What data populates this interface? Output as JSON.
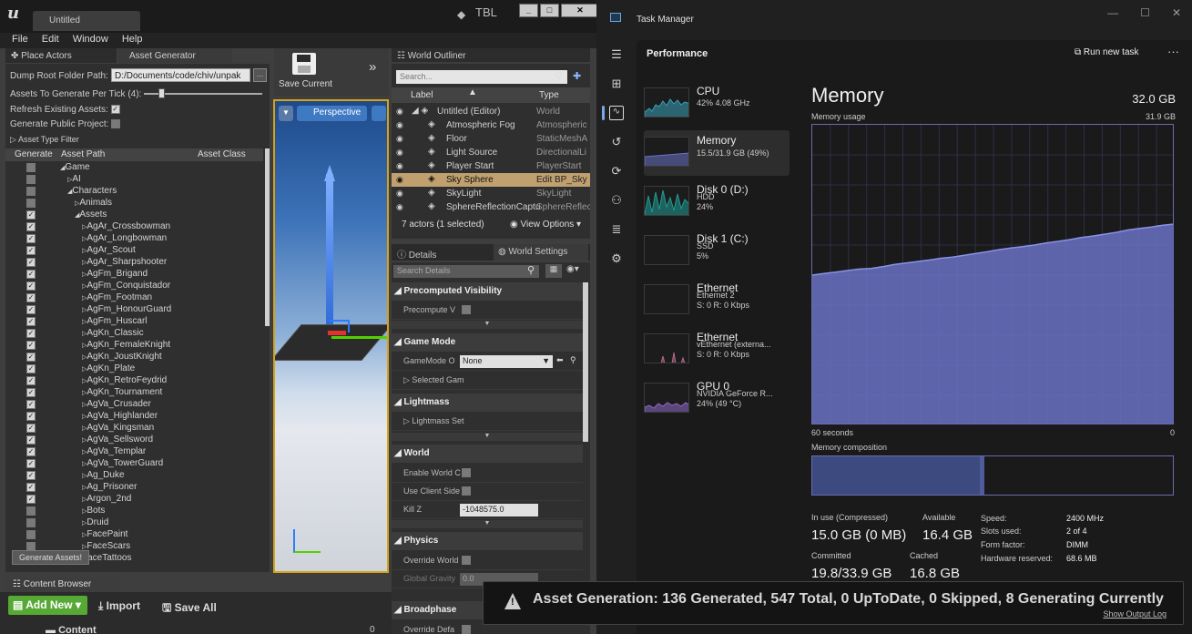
{
  "ue": {
    "tab_title": "Untitled",
    "tbl": "TBL",
    "menu": [
      "File",
      "Edit",
      "Window",
      "Help"
    ],
    "tabs": {
      "place_actors": "Place Actors",
      "asset_generator": "Asset Generator"
    },
    "asset_gen": {
      "dump_label": "Dump Root Folder Path:",
      "dump_value": "D:/Documents/code/chiv/unpak",
      "per_tick_label": "Assets To Generate Per Tick (4):",
      "refresh_label": "Refresh Existing Assets:",
      "public_label": "Generate Public Project:",
      "filter_label": "Asset Type Filter",
      "col_generate": "Generate",
      "col_path": "Asset Path",
      "col_class": "Asset Class",
      "generate_btn": "Generate Assets!",
      "tree": [
        {
          "label": "Game",
          "indent": 0,
          "arrow": "open",
          "checked": false
        },
        {
          "label": "AI",
          "indent": 1,
          "arrow": "closed",
          "checked": false
        },
        {
          "label": "Characters",
          "indent": 1,
          "arrow": "open",
          "checked": false
        },
        {
          "label": "Animals",
          "indent": 2,
          "arrow": "closed",
          "checked": false
        },
        {
          "label": "Assets",
          "indent": 2,
          "arrow": "open",
          "checked": true
        },
        {
          "label": "AgAr_Crossbowman",
          "indent": 3,
          "arrow": "closed",
          "checked": true
        },
        {
          "label": "AgAr_Longbowman",
          "indent": 3,
          "arrow": "closed",
          "checked": true
        },
        {
          "label": "AgAr_Scout",
          "indent": 3,
          "arrow": "closed",
          "checked": true
        },
        {
          "label": "AgAr_Sharpshooter",
          "indent": 3,
          "arrow": "closed",
          "checked": true
        },
        {
          "label": "AgFm_Brigand",
          "indent": 3,
          "arrow": "closed",
          "checked": true
        },
        {
          "label": "AgFm_Conquistador",
          "indent": 3,
          "arrow": "closed",
          "checked": true
        },
        {
          "label": "AgFm_Footman",
          "indent": 3,
          "arrow": "closed",
          "checked": true
        },
        {
          "label": "AgFm_HonourGuard",
          "indent": 3,
          "arrow": "closed",
          "checked": true
        },
        {
          "label": "AgFm_Huscarl",
          "indent": 3,
          "arrow": "closed",
          "checked": true
        },
        {
          "label": "AgKn_Classic",
          "indent": 3,
          "arrow": "closed",
          "checked": true
        },
        {
          "label": "AgKn_FemaleKnight",
          "indent": 3,
          "arrow": "closed",
          "checked": true
        },
        {
          "label": "AgKn_JoustKnight",
          "indent": 3,
          "arrow": "closed",
          "checked": true
        },
        {
          "label": "AgKn_Plate",
          "indent": 3,
          "arrow": "closed",
          "checked": true
        },
        {
          "label": "AgKn_RetroFeydrid",
          "indent": 3,
          "arrow": "closed",
          "checked": true
        },
        {
          "label": "AgKn_Tournament",
          "indent": 3,
          "arrow": "closed",
          "checked": true
        },
        {
          "label": "AgVa_Crusader",
          "indent": 3,
          "arrow": "closed",
          "checked": true
        },
        {
          "label": "AgVa_Highlander",
          "indent": 3,
          "arrow": "closed",
          "checked": true
        },
        {
          "label": "AgVa_Kingsman",
          "indent": 3,
          "arrow": "closed",
          "checked": true
        },
        {
          "label": "AgVa_Sellsword",
          "indent": 3,
          "arrow": "closed",
          "checked": true
        },
        {
          "label": "AgVa_Templar",
          "indent": 3,
          "arrow": "closed",
          "checked": true
        },
        {
          "label": "AgVa_TowerGuard",
          "indent": 3,
          "arrow": "closed",
          "checked": true
        },
        {
          "label": "Ag_Duke",
          "indent": 3,
          "arrow": "closed",
          "checked": true
        },
        {
          "label": "Ag_Prisoner",
          "indent": 3,
          "arrow": "closed",
          "checked": true
        },
        {
          "label": "Argon_2nd",
          "indent": 3,
          "arrow": "closed",
          "checked": true
        },
        {
          "label": "Bots",
          "indent": 3,
          "arrow": "closed",
          "checked": false
        },
        {
          "label": "Druid",
          "indent": 3,
          "arrow": "closed",
          "checked": false
        },
        {
          "label": "FacePaint",
          "indent": 3,
          "arrow": "closed",
          "checked": false
        },
        {
          "label": "FaceScars",
          "indent": 3,
          "arrow": "closed",
          "checked": false
        },
        {
          "label": "FaceTattoos",
          "indent": 3,
          "arrow": "none",
          "checked": false
        }
      ]
    },
    "toolbar": {
      "save_label": "Save Current"
    },
    "viewport": {
      "perspective": "Perspective"
    },
    "outliner": {
      "tab": "World Outliner",
      "search_placeholder": "Search...",
      "col_label": "Label",
      "col_type": "Type",
      "rows": [
        {
          "label": "Untitled (Editor)",
          "type": "World",
          "selected": false
        },
        {
          "label": "Atmospheric Fog",
          "type": "Atmospheric",
          "selected": false
        },
        {
          "label": "Floor",
          "type": "StaticMeshA",
          "selected": false
        },
        {
          "label": "Light Source",
          "type": "DirectionalLi",
          "selected": false
        },
        {
          "label": "Player Start",
          "type": "PlayerStart",
          "selected": false
        },
        {
          "label": "Sky Sphere",
          "type": "Edit BP_Sky",
          "selected": true
        },
        {
          "label": "SkyLight",
          "type": "SkyLight",
          "selected": false
        },
        {
          "label": "SphereReflectionCaptu",
          "type": "SphereReflec",
          "selected": false
        }
      ],
      "actors_count": "7 actors (1 selected)",
      "view_options": "View Options"
    },
    "details": {
      "tab_details": "Details",
      "tab_world": "World Settings",
      "search_placeholder": "Search Details",
      "sections": {
        "precomputed": "Precomputed Visibility",
        "game_mode": "Game Mode",
        "lightmass": "Lightmass",
        "world": "World",
        "physics": "Physics",
        "broadphase": "Broadphase"
      },
      "rows": {
        "precompute": "Precompute V",
        "gamemode": "GameMode O",
        "gamemode_value": "None",
        "selected_game": "Selected Gam",
        "lightmass_set": "Lightmass Set",
        "enable_world": "Enable World C",
        "use_client": "Use Client Side",
        "kill_z": "Kill Z",
        "kill_z_value": "-1048575.0",
        "override_world": "Override World",
        "global_gravity": "Global Gravity",
        "global_gravity_value": "0.0",
        "override_default": "Override Defa"
      }
    },
    "content_browser": {
      "tab": "Content Browser",
      "add_new": "Add New",
      "import": "Import",
      "save_all": "Save All",
      "content": "Content",
      "count": "0"
    },
    "notification": {
      "text": "Asset Generation: 136 Generated, 547 Total, 0 UpToDate, 0 Skipped, 8 Generating Currently",
      "link": "Show Output Log"
    }
  },
  "tm": {
    "title": "Task Manager",
    "section": "Performance",
    "run_new_task": "Run new task",
    "items": [
      {
        "name": "CPU",
        "sub1": "42% 4.08 GHz",
        "sub2": "",
        "sub3": "",
        "color": "#3aa0b8"
      },
      {
        "name": "Memory",
        "sub1": "15.5/31.9 GB (49%)",
        "sub2": "",
        "sub3": "",
        "color": "#6b73c9"
      },
      {
        "name": "Disk 0 (D:)",
        "sub1": "HDD",
        "sub2": "24%",
        "sub3": "",
        "color": "#1f9c93"
      },
      {
        "name": "Disk 1 (C:)",
        "sub1": "SSD",
        "sub2": "5%",
        "sub3": "",
        "color": "#1f9c93"
      },
      {
        "name": "Ethernet",
        "sub1": "Ethernet 2",
        "sub2": "S: 0 R: 0 Kbps",
        "sub3": "",
        "color": "#b06a8a"
      },
      {
        "name": "Ethernet",
        "sub1": "vEthernet (externa...",
        "sub2": "S: 0 R: 0 Kbps",
        "sub3": "",
        "color": "#b06a8a"
      },
      {
        "name": "GPU 0",
        "sub1": "NVIDIA GeForce R...",
        "sub2": "24% (49 °C)",
        "sub3": "",
        "color": "#8f6ac9"
      }
    ],
    "memory": {
      "title": "Memory",
      "total": "32.0 GB",
      "usage_label": "Memory usage",
      "usage_max": "31.9 GB",
      "seconds": "60 seconds",
      "zero": "0",
      "composition_label": "Memory composition",
      "composition_in_use_fraction": 0.47,
      "in_use_label": "In use (Compressed)",
      "in_use_value": "15.0 GB (0 MB)",
      "available_label": "Available",
      "available_value": "16.4 GB",
      "committed_label": "Committed",
      "committed_value": "19.8/33.9 GB",
      "cached_label": "Cached",
      "cached_value": "16.8 GB",
      "kv": [
        {
          "k": "Speed:",
          "v": "2400 MHz"
        },
        {
          "k": "Slots used:",
          "v": "2 of 4"
        },
        {
          "k": "Form factor:",
          "v": "DIMM"
        },
        {
          "k": "Hardware reserved:",
          "v": "68.6 MB"
        }
      ],
      "usage_series": [
        0.5,
        0.505,
        0.51,
        0.515,
        0.52,
        0.522,
        0.528,
        0.535,
        0.54,
        0.545,
        0.55,
        0.556,
        0.56,
        0.566,
        0.572,
        0.578,
        0.585,
        0.59,
        0.595,
        0.6,
        0.607,
        0.612,
        0.618,
        0.625,
        0.63,
        0.636,
        0.642,
        0.65,
        0.655,
        0.66,
        0.666,
        0.67
      ]
    }
  }
}
